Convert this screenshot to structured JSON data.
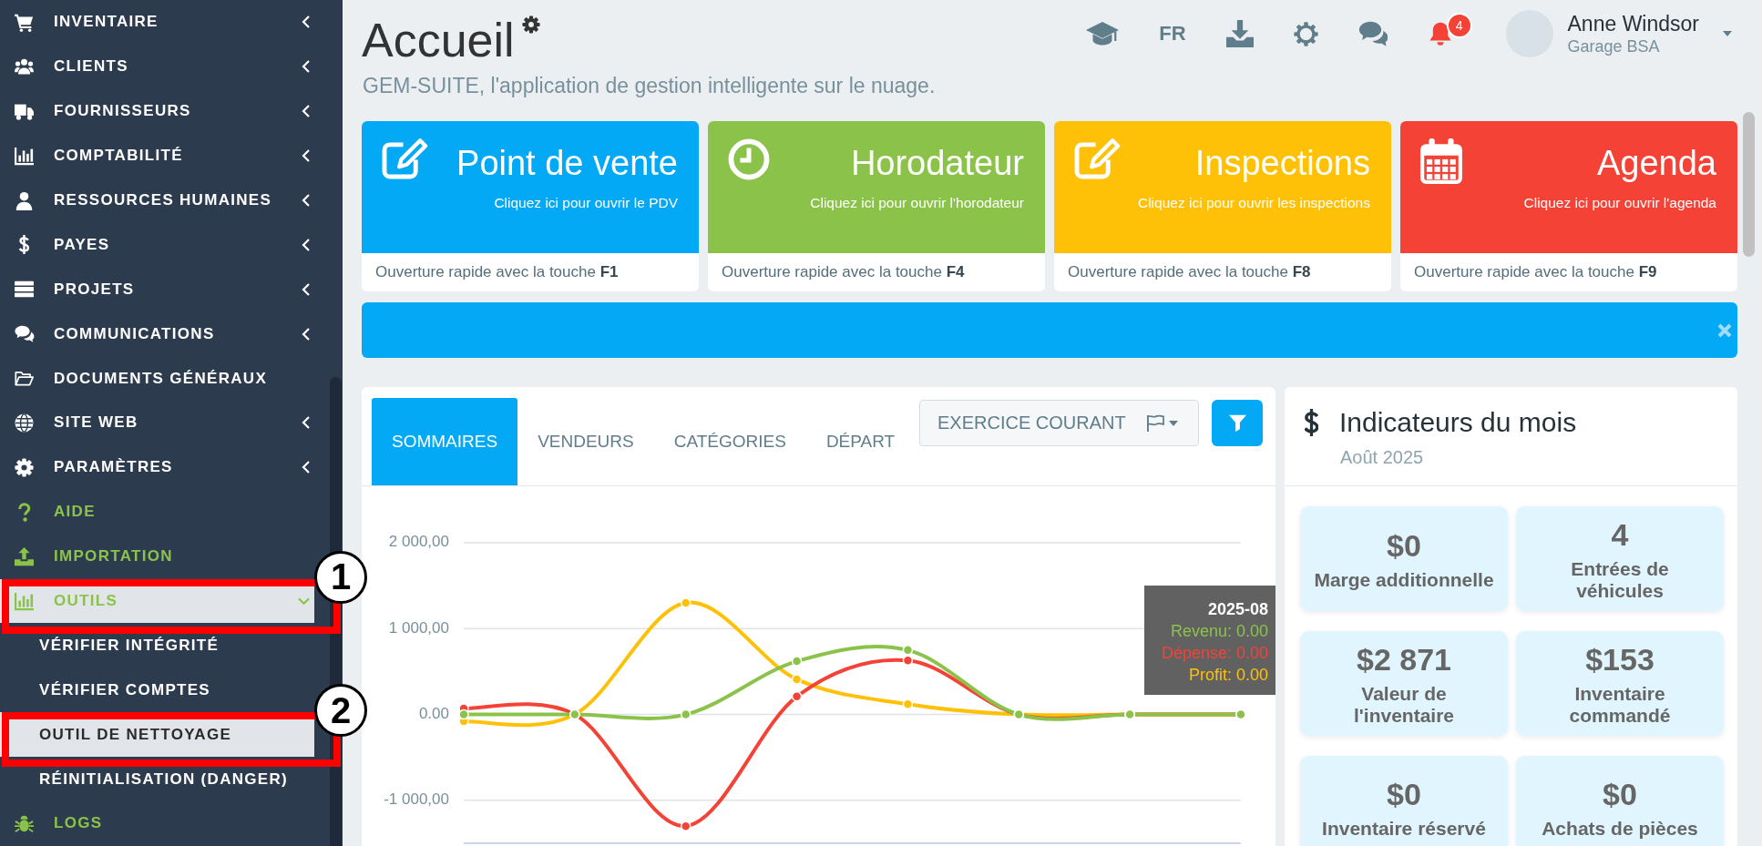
{
  "sidebar": {
    "items": [
      {
        "label": "INVENTAIRE",
        "kind": "group",
        "expanded": false,
        "selected": false,
        "color": "#ffffff"
      },
      {
        "label": "CLIENTS",
        "kind": "group",
        "expanded": false,
        "selected": false,
        "color": "#ffffff"
      },
      {
        "label": "FOURNISSEURS",
        "kind": "group",
        "expanded": false,
        "selected": false,
        "color": "#ffffff"
      },
      {
        "label": "COMPTABILITÉ",
        "kind": "group",
        "expanded": false,
        "selected": false,
        "color": "#ffffff"
      },
      {
        "label": "RESSOURCES HUMAINES",
        "kind": "group",
        "expanded": false,
        "selected": false,
        "color": "#ffffff"
      },
      {
        "label": "PAYES",
        "kind": "group",
        "expanded": false,
        "selected": false,
        "color": "#ffffff"
      },
      {
        "label": "PROJETS",
        "kind": "group",
        "expanded": false,
        "selected": false,
        "color": "#ffffff"
      },
      {
        "label": "COMMUNICATIONS",
        "kind": "group",
        "expanded": false,
        "selected": false,
        "color": "#ffffff"
      },
      {
        "label": "DOCUMENTS GÉNÉRAUX",
        "kind": "link",
        "selected": false,
        "color": "#ffffff"
      },
      {
        "label": "SITE WEB",
        "kind": "group",
        "expanded": false,
        "selected": false,
        "color": "#ffffff"
      },
      {
        "label": "PARAMÈTRES",
        "kind": "group",
        "expanded": false,
        "selected": false,
        "color": "#ffffff"
      },
      {
        "label": "AIDE",
        "kind": "link",
        "selected": false,
        "color": "#8bc34a"
      },
      {
        "label": "IMPORTATION",
        "kind": "link",
        "selected": false,
        "color": "#8bc34a"
      },
      {
        "label": "OUTILS",
        "kind": "group",
        "expanded": true,
        "selected": true,
        "color": "#8bc34a",
        "callout": "1",
        "children": [
          {
            "label": "VÉRIFIER INTÉGRITÉ",
            "selected": false
          },
          {
            "label": "VÉRIFIER COMPTES",
            "selected": false
          },
          {
            "label": "OUTIL DE NETTOYAGE",
            "selected": true,
            "callout": "2"
          },
          {
            "label": "RÉINITIALISATION (DANGER)",
            "selected": false
          }
        ]
      },
      {
        "label": "LOGS",
        "kind": "link",
        "selected": false,
        "color": "#8bc34a"
      }
    ]
  },
  "header": {
    "title": "Accueil",
    "subtitle": "GEM-SUITE, l'application de gestion intelligente sur le nuage.",
    "language": "FR",
    "notifications": "4",
    "user": {
      "name": "Anne Windsor",
      "company": "Garage BSA"
    }
  },
  "shortcuts": [
    {
      "title": "Point de vente",
      "subtitle": "Cliquez ici pour ouvrir le PDV",
      "hint": "Ouverture rapide avec la touche **F1**",
      "color": "#03a9f4"
    },
    {
      "title": "Horodateur",
      "subtitle": "Cliquez ici pour ouvrir l'horodateur",
      "hint": "Ouverture rapide avec la touche **F4**",
      "color": "#8bc34a"
    },
    {
      "title": "Inspections",
      "subtitle": "Cliquez ici pour ouvrir les inspections",
      "hint": "Ouverture rapide avec la touche **F8**",
      "color": "#ffc107"
    },
    {
      "title": "Agenda",
      "subtitle": "Cliquez ici pour ouvrir l'agenda",
      "hint": "Ouverture rapide avec la touche **F9**",
      "color": "#f44336"
    }
  ],
  "banner": {
    "dismissible": true
  },
  "sales_panel": {
    "tabs": [
      {
        "label": "SOMMAIRES",
        "selected": true
      },
      {
        "label": "VENDEURS",
        "selected": false
      },
      {
        "label": "CATÉGORIES",
        "selected": false
      },
      {
        "label": "DÉPART",
        "selected": false
      }
    ],
    "period_button": "EXERCICE COURANT",
    "chart_data": {
      "type": "line",
      "grid": true,
      "series": [
        {
          "name": "Revenu",
          "color": "#8bc34a",
          "marker": true,
          "values": [
            0,
            0,
            0,
            620,
            750,
            0,
            0,
            0
          ]
        },
        {
          "name": "Dépense",
          "color": "#f44336",
          "marker": true,
          "values": [
            70,
            0,
            -1300,
            210,
            630,
            0,
            0,
            0
          ]
        },
        {
          "name": "Profit",
          "color": "#ffc107",
          "marker": true,
          "values": [
            -80,
            0,
            1300,
            410,
            120,
            0,
            0,
            0
          ]
        }
      ],
      "ylim": [
        -1500,
        2000
      ],
      "yticks": [
        {
          "value": -1000,
          "label": "-1 000,00"
        },
        {
          "value": 0,
          "label": "0.00"
        },
        {
          "value": 1000,
          "label": "1 000,00"
        },
        {
          "value": 2000,
          "label": "2 000,00"
        }
      ]
    },
    "tooltip": {
      "title": "2025-08",
      "separator": ":",
      "values": [
        "0.00",
        "0.00",
        "0.00"
      ]
    }
  },
  "indicators": {
    "title": "Indicateurs du mois",
    "period": "Août 2025",
    "tiles": [
      {
        "value": "$0",
        "label": "Marge additionnelle"
      },
      {
        "value": "4",
        "label": "Entrées de\nvéhicules"
      },
      {
        "value": "$2 871",
        "label": "Valeur de\nl'inventaire"
      },
      {
        "value": "$153",
        "label": "Inventaire\ncommandé"
      },
      {
        "value": "$0",
        "label": "Inventaire réservé"
      },
      {
        "value": "$0",
        "label": "Achats de pièces"
      }
    ]
  }
}
